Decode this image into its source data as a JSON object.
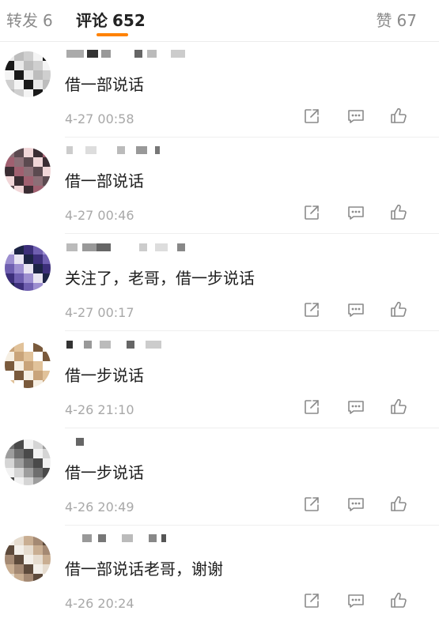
{
  "tabs": {
    "repost": {
      "label": "转发",
      "count": "6"
    },
    "comment": {
      "label": "评论",
      "count": "652"
    },
    "like": {
      "label": "赞",
      "count": "67"
    }
  },
  "accent_color": "#ff8200",
  "action_icons": [
    "share-icon",
    "reply-icon",
    "thumbs-up-icon"
  ],
  "comments": [
    {
      "text": "借一部说话",
      "time": "4-27 00:58"
    },
    {
      "text": "借一部说话",
      "time": "4-27 00:46"
    },
    {
      "text": "关注了，老哥，借一步说话",
      "time": "4-27 00:17"
    },
    {
      "text": "借一步说话",
      "time": "4-26 21:10"
    },
    {
      "text": "借一步说话",
      "time": "4-26 20:49"
    },
    {
      "text": "借一部说话老哥，谢谢",
      "time": "4-26 20:24"
    }
  ]
}
